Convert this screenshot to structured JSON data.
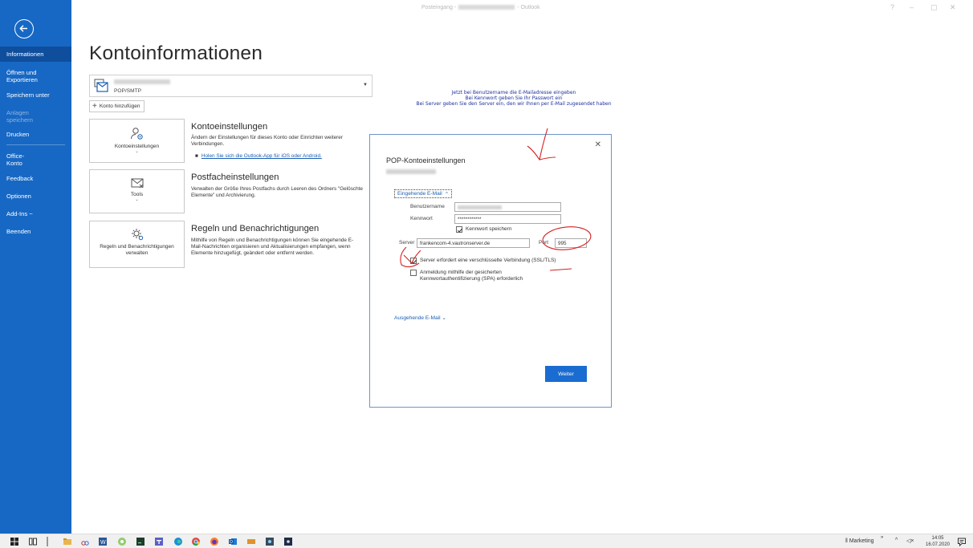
{
  "window": {
    "title_prefix": "Posteingang -",
    "title_suffix": "- Outlook",
    "help": "?",
    "minimize": "–",
    "maximize": "▢",
    "close": "✕"
  },
  "sidebar": {
    "items": [
      {
        "label": "Informationen"
      },
      {
        "label": "Öffnen und Exportieren"
      },
      {
        "label": "Speichern unter"
      },
      {
        "label": "Anlagen speichern"
      },
      {
        "label": "Drucken"
      },
      {
        "label": "Office-Konto"
      },
      {
        "label": "Feedback"
      },
      {
        "label": "Optionen"
      },
      {
        "label": "Add-Ins ~"
      },
      {
        "label": "Beenden"
      }
    ]
  },
  "main": {
    "title": "Kontoinformationen",
    "account_type": "POP/SMTP",
    "add_account": "Konto hinzufügen",
    "tiles": {
      "settings": {
        "label": "Kontoeinstellungen",
        "caret": "⌄"
      },
      "tools": {
        "label": "Tools",
        "caret": "⌄"
      },
      "rules": {
        "label": "Regeln und Benachrichtigungen verwalten"
      }
    },
    "sections": {
      "settings": {
        "title": "Kontoeinstellungen",
        "desc": "Ändern der Einstellungen für dieses Konto oder Einrichten weiterer Verbindungen.",
        "link": "Holen Sie sich die Outlook-App für iOS oder Android."
      },
      "mailbox": {
        "title": "Postfacheinstellungen",
        "desc": "Verwalten der Größe Ihres Postfachs durch Leeren des Ordners \"Gelöschte Elemente\" und Archivierung."
      },
      "rules": {
        "title": "Regeln und Benachrichtigungen",
        "desc": "Mithilfe von Regeln und Benachrichtigungen können Sie eingehende E-Mail-Nachrichten organisieren und Aktualisierungen empfangen, wenn Elemente hinzugefügt, geändert oder entfernt werden."
      }
    }
  },
  "annotation": {
    "line1": "Jetzt bei Benutzername die E-Mailadresse eingeben",
    "line2": "Bei Kennwort geben Sie Ihr Passwort ein",
    "line3": "Bei Server geben Sie den Server ein, den wir Ihnen per E-Mail zugesendet haben"
  },
  "dialog": {
    "title": "POP-Kontoeinstellungen",
    "incoming_label": "Eingehende E-Mail",
    "username_label": "Benutzername",
    "password_label": "Kennwort",
    "password_value": "************",
    "save_password": "Kennwort speichern",
    "save_password_checked": true,
    "server_label": "Server",
    "server_value": "frankencom-4.vautronserver.de",
    "port_label": "Port",
    "port_value": "995",
    "ssl_label": "Server erfordert eine verschlüsselte Verbindung (SSL/TLS)",
    "ssl_checked": true,
    "spa_label": "Anmeldung mithilfe der gesicherten Kennwortauthentifizierung (SPA) erforderlich",
    "spa_checked": false,
    "outgoing_label": "Ausgehende E-Mail",
    "next_button": "Weiter",
    "close": "✕"
  },
  "taskbar": {
    "marketing": "Marketing",
    "overflow": "»",
    "chevron": "^",
    "volume": "◁×",
    "time": "14:05",
    "date": "16.07.2020"
  },
  "colors": {
    "sidebar": "#1768c4",
    "sidebar_active": "#0f4e9c",
    "link": "#1a5fb4",
    "button": "#1a6cd0",
    "annotation": "#1c2f9e",
    "red_marks": "#d42020"
  }
}
